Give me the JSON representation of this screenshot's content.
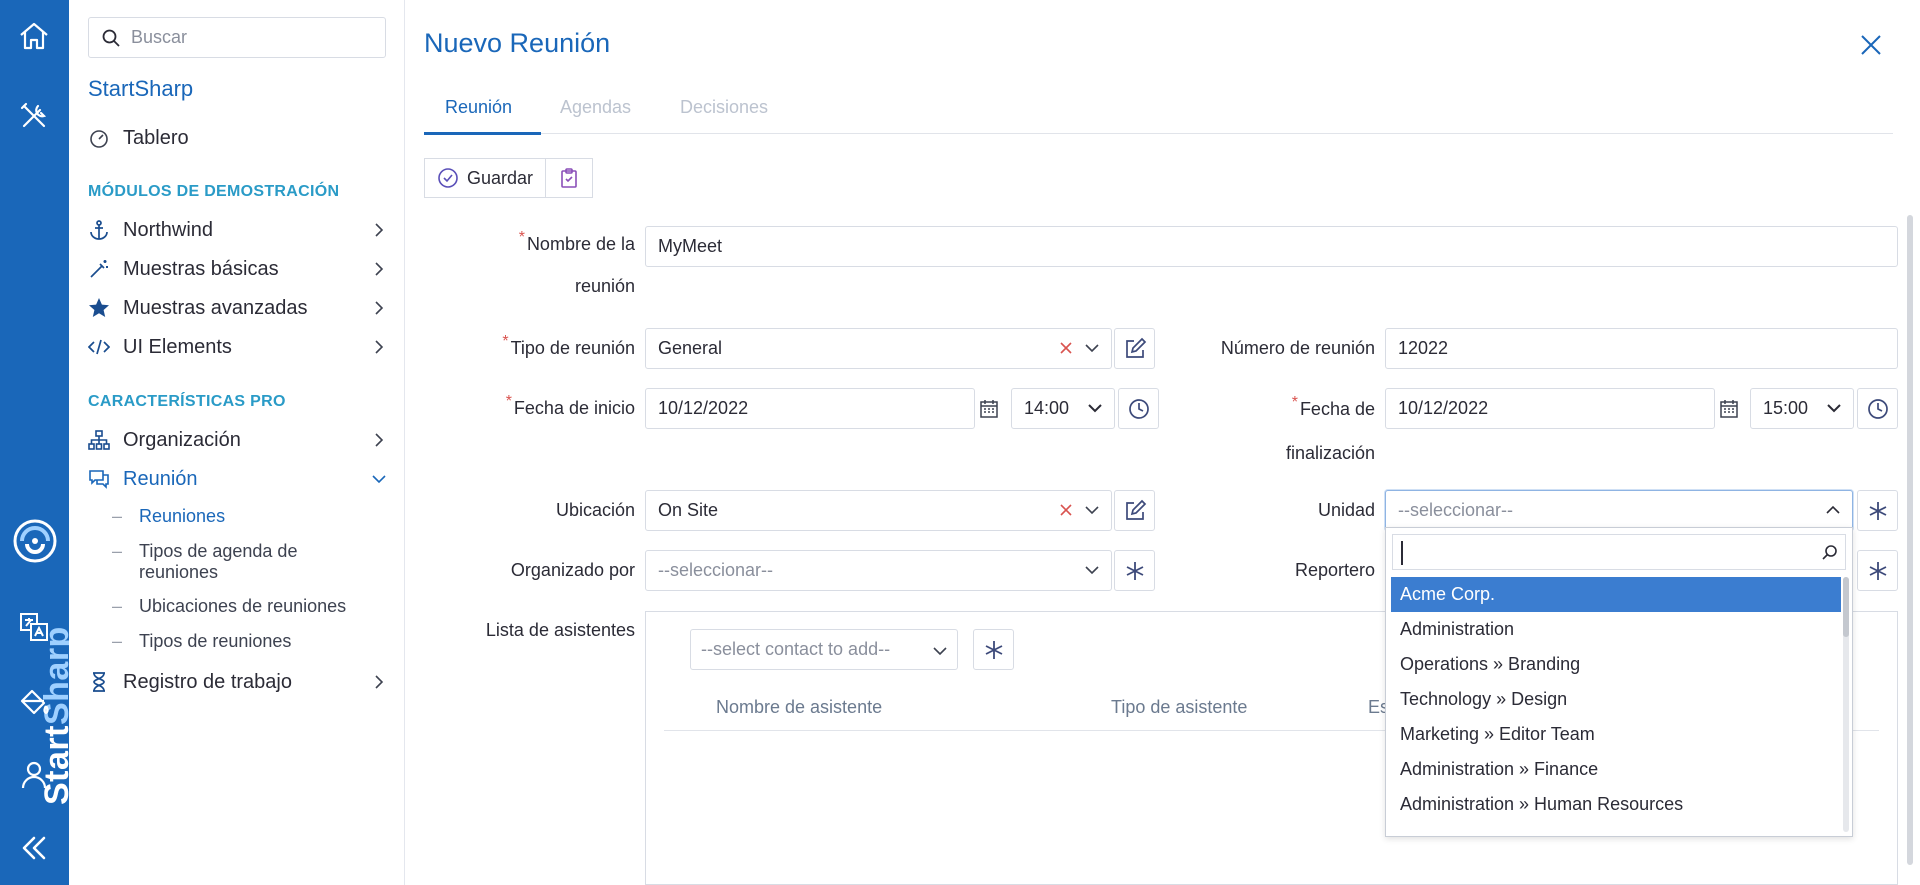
{
  "rail": {
    "brand": {
      "start": "Start",
      "sharp": "Sharp"
    },
    "icons": [
      "home-icon",
      "tools-icon",
      "translate-icon",
      "paint-bucket-icon",
      "user-icon",
      "collapse-icon"
    ]
  },
  "sidebar": {
    "search_placeholder": "Buscar",
    "app_title": "StartSharp",
    "dashboard": "Tablero",
    "section_demo": "MÓDULOS DE DEMOSTRACIÓN",
    "demo_items": [
      {
        "label": "Northwind",
        "icon": "anchor-icon"
      },
      {
        "label": "Muestras básicas",
        "icon": "magic-wand-icon"
      },
      {
        "label": "Muestras avanzadas",
        "icon": "star-icon"
      },
      {
        "label": "UI Elements",
        "icon": "code-icon"
      }
    ],
    "section_pro": "CARACTERÍSTICAS PRO",
    "pro_items": [
      {
        "label": "Organización",
        "icon": "org-chart-icon"
      },
      {
        "label": "Reunión",
        "icon": "chat-icon"
      }
    ],
    "meeting_subitems": [
      "Reuniones",
      "Tipos de agenda de reuniones",
      "Ubicaciones de reuniones",
      "Tipos de reuniones"
    ],
    "worklog": "Registro de trabajo"
  },
  "main": {
    "title": "Nuevo Reunión",
    "tabs": [
      "Reunión",
      "Agendas",
      "Decisiones"
    ],
    "toolbar": {
      "save_label": "Guardar"
    },
    "form": {
      "meeting_name_label": "Nombre de la reunión",
      "meeting_name_value": "MyMeet",
      "meeting_type_label": "Tipo de reunión",
      "meeting_type_value": "General",
      "meeting_number_label": "Número de reunión",
      "meeting_number_value": "12022",
      "start_date_label": "Fecha de inicio",
      "start_date_value": "10/12/2022",
      "start_time_value": "14:00",
      "end_date_label": "Fecha de finalización",
      "end_date_value": "10/12/2022",
      "end_time_value": "15:00",
      "location_label": "Ubicación",
      "location_value": "On Site",
      "unit_label": "Unidad",
      "unit_placeholder": "--seleccionar--",
      "organizer_label": "Organizado por",
      "organizer_placeholder": "--seleccionar--",
      "reporter_label": "Reportero",
      "attendees_label": "Lista de asistentes",
      "attendee_select_placeholder": "--select contact to add--",
      "attendee_columns": [
        "Nombre de asistente",
        "Tipo de asistente",
        "Es"
      ]
    },
    "unit_dropdown": {
      "search_value": "",
      "options": [
        "Acme Corp.",
        "Administration",
        "Operations » Branding",
        "Technology » Design",
        "Marketing » Editor Team",
        "Administration » Finance",
        "Administration » Human Resources"
      ],
      "selected": "Acme Corp."
    }
  },
  "colors": {
    "accent": "#1a67b9",
    "rail": "#1a67b9",
    "section": "#2a9bc7",
    "required": "#d9534f",
    "selected_option": "#3b7dd0"
  }
}
